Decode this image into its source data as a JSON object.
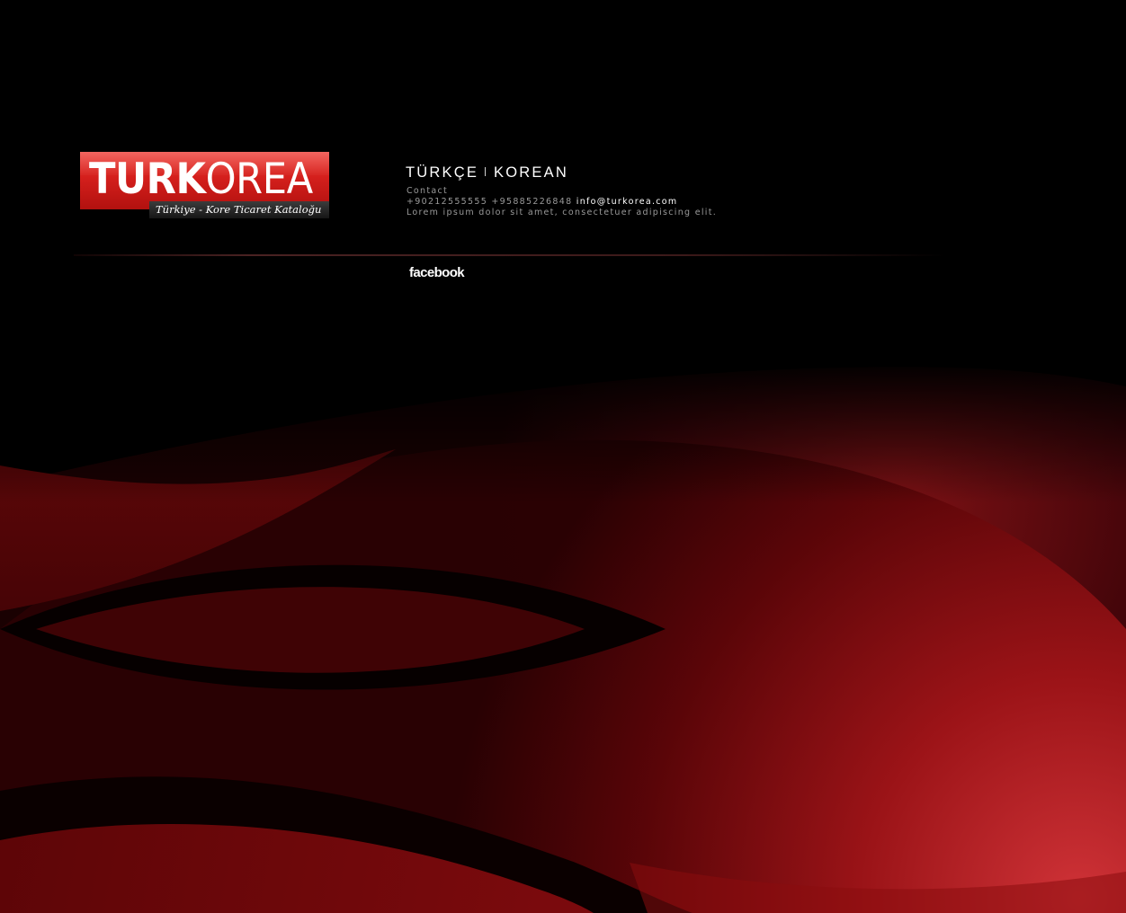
{
  "logo": {
    "word_bold": "TURK",
    "word_thin": "OREA",
    "tagline": "Türkiye - Kore Ticaret Kataloğu"
  },
  "nav": {
    "languages": [
      "TÜRKÇE",
      "KOREAN"
    ]
  },
  "contact": {
    "label": "Contact",
    "phones": "+90212555555 +95885226848",
    "email": "info@turkorea.com",
    "description": "Lorem ipsum dolor sit amet, consectetuer adipiscing elit."
  },
  "social": {
    "facebook_label": "facebook"
  },
  "colors": {
    "background": "#000000",
    "brand_red": "#d41f1c",
    "wave_dark_red": "#5a0608"
  }
}
